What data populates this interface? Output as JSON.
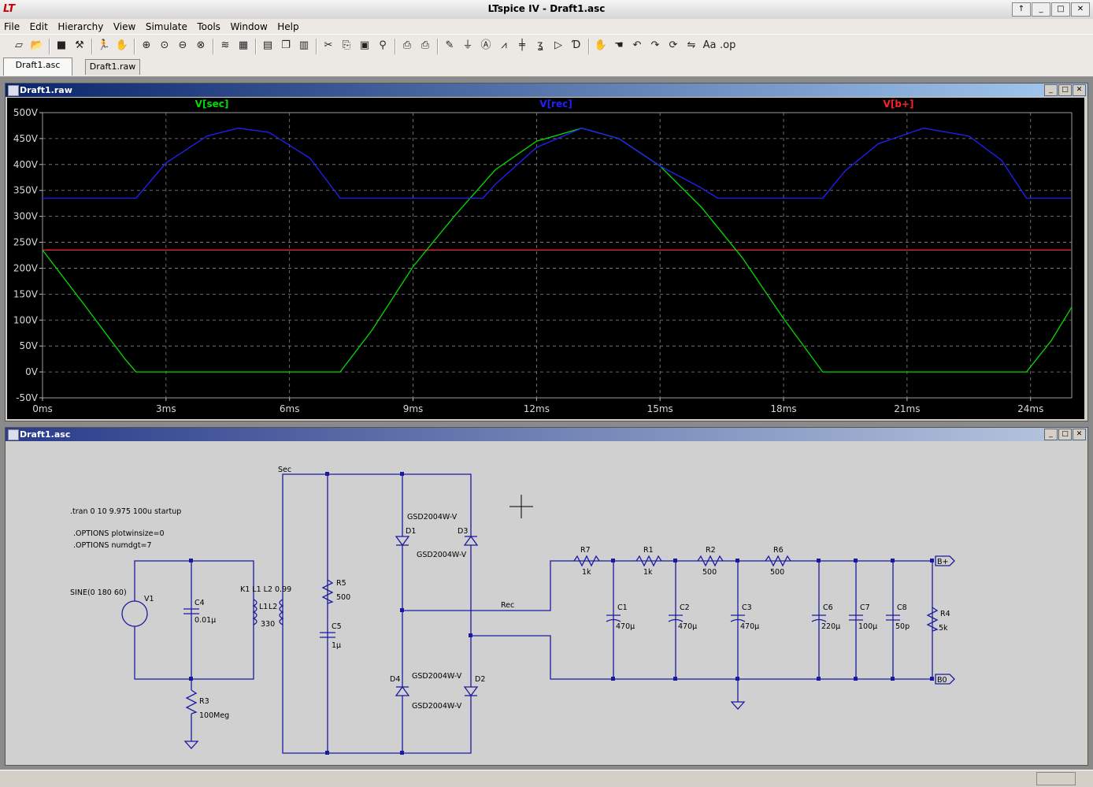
{
  "app": {
    "title": "LTspice IV - Draft1.asc",
    "logo": "LT",
    "window_buttons": [
      "↑",
      "_",
      "□",
      "✕"
    ]
  },
  "menu": [
    "File",
    "Edit",
    "Hierarchy",
    "View",
    "Simulate",
    "Tools",
    "Window",
    "Help"
  ],
  "toolbar_icons": [
    "new-schematic-icon",
    "open-icon",
    "save-icon",
    "control-panel-icon",
    "run-icon",
    "halt-icon",
    "zoom-in-icon",
    "zoom-pan-icon",
    "zoom-out-icon",
    "zoom-cancel-icon",
    "autorange-icon",
    "view-grid-icon",
    "tile-horizontal-icon",
    "cascade-icon",
    "tile-vertical-icon",
    "cut-icon",
    "copy-icon",
    "paste-icon",
    "find-icon",
    "print-preview-icon",
    "print-icon",
    "draw-wire-icon",
    "ground-icon",
    "label-net-icon",
    "resistor-icon",
    "capacitor-icon",
    "inductor-icon",
    "diode-icon",
    "component-icon",
    "move-icon",
    "drag-icon",
    "undo-icon",
    "redo-icon",
    "rotate-icon",
    "mirror-icon",
    "text-icon",
    "spice-directive-icon"
  ],
  "tabs": [
    {
      "label": "Draft1.asc",
      "active": true
    },
    {
      "label": "Draft1.raw",
      "active": false
    }
  ],
  "waveform_window": {
    "title": "Draft1.raw",
    "traces": [
      {
        "name": "V[sec]",
        "color": "#00dd00"
      },
      {
        "name": "V[rec]",
        "color": "#2020ff"
      },
      {
        "name": "V[b+]",
        "color": "#ff2020"
      }
    ],
    "y_ticks": [
      "500V",
      "450V",
      "400V",
      "350V",
      "300V",
      "250V",
      "200V",
      "150V",
      "100V",
      "50V",
      "0V",
      "-50V"
    ],
    "x_ticks": [
      "0ms",
      "3ms",
      "6ms",
      "9ms",
      "12ms",
      "15ms",
      "18ms",
      "21ms",
      "24ms"
    ]
  },
  "chart_data": {
    "type": "line",
    "xlabel": "",
    "ylabel": "",
    "xlim": [
      0,
      25
    ],
    "ylim": [
      -50,
      500
    ],
    "x_unit": "ms",
    "y_unit": "V",
    "grid": true,
    "background": "#000000",
    "series": [
      {
        "name": "V[sec]",
        "color": "#00dd00",
        "x": [
          0,
          1,
          2,
          2.27,
          7.23,
          8,
          9,
          10,
          11,
          12,
          13.1,
          14,
          15,
          16,
          17,
          18,
          18.95,
          23.9,
          24.5,
          25
        ],
        "y": [
          235,
          131,
          25,
          0,
          0,
          80,
          203,
          300,
          390,
          445,
          470,
          450,
          397,
          318,
          220,
          103,
          0,
          0,
          60,
          125
        ]
      },
      {
        "name": "V[rec]",
        "color": "#2020ff",
        "x": [
          0,
          2.27,
          3,
          4,
          4.75,
          5.5,
          6.5,
          7.23,
          10.7,
          11,
          12,
          13.1,
          14,
          15,
          16,
          16.4,
          18.95,
          19.5,
          20.3,
          21.4,
          22.5,
          23.3,
          23.9,
          25
        ],
        "y": [
          335,
          335,
          403,
          455,
          470,
          462,
          412,
          335,
          335,
          362,
          433,
          470,
          450,
          397,
          355,
          335,
          335,
          388,
          440,
          470,
          455,
          408,
          335,
          335
        ]
      },
      {
        "name": "V[b+]",
        "color": "#ff2020",
        "x": [
          0,
          25
        ],
        "y": [
          235,
          235
        ]
      }
    ]
  },
  "schematic_window": {
    "title": "Draft1.asc",
    "directives": [
      ".tran 0 10 9.975 100u startup",
      ".OPTIONS plotwinsize=0",
      ".OPTIONS numdgt=7",
      "K1 L1 L2 0.99"
    ],
    "source": {
      "ref": "V1",
      "value": "SINE(0 180 60)"
    },
    "components": [
      {
        "ref": "C4",
        "value": "0.01µ"
      },
      {
        "ref": "R3",
        "value": "100Meg"
      },
      {
        "ref": "L1",
        "value": ""
      },
      {
        "ref": "L2",
        "value": "330"
      },
      {
        "ref": "R5",
        "value": "500"
      },
      {
        "ref": "C5",
        "value": "1µ"
      },
      {
        "ref": "D1",
        "value": "GSD2004W-V"
      },
      {
        "ref": "D3",
        "value": "GSD2004W-V"
      },
      {
        "ref": "D4",
        "value": "GSD2004W-V"
      },
      {
        "ref": "D2",
        "value": "GSD2004W-V"
      },
      {
        "ref": "R7",
        "value": "1k"
      },
      {
        "ref": "R1",
        "value": "1k"
      },
      {
        "ref": "R2",
        "value": "500"
      },
      {
        "ref": "R6",
        "value": "500"
      },
      {
        "ref": "C1",
        "value": "470µ"
      },
      {
        "ref": "C2",
        "value": "470µ"
      },
      {
        "ref": "C3",
        "value": "470µ"
      },
      {
        "ref": "C6",
        "value": "220µ"
      },
      {
        "ref": "C7",
        "value": "100µ"
      },
      {
        "ref": "C8",
        "value": "50p"
      },
      {
        "ref": "R4",
        "value": "5k"
      }
    ],
    "net_labels": [
      "Sec",
      "Rec",
      "B+",
      "B0"
    ],
    "wire_color": "#1a1aa0"
  }
}
